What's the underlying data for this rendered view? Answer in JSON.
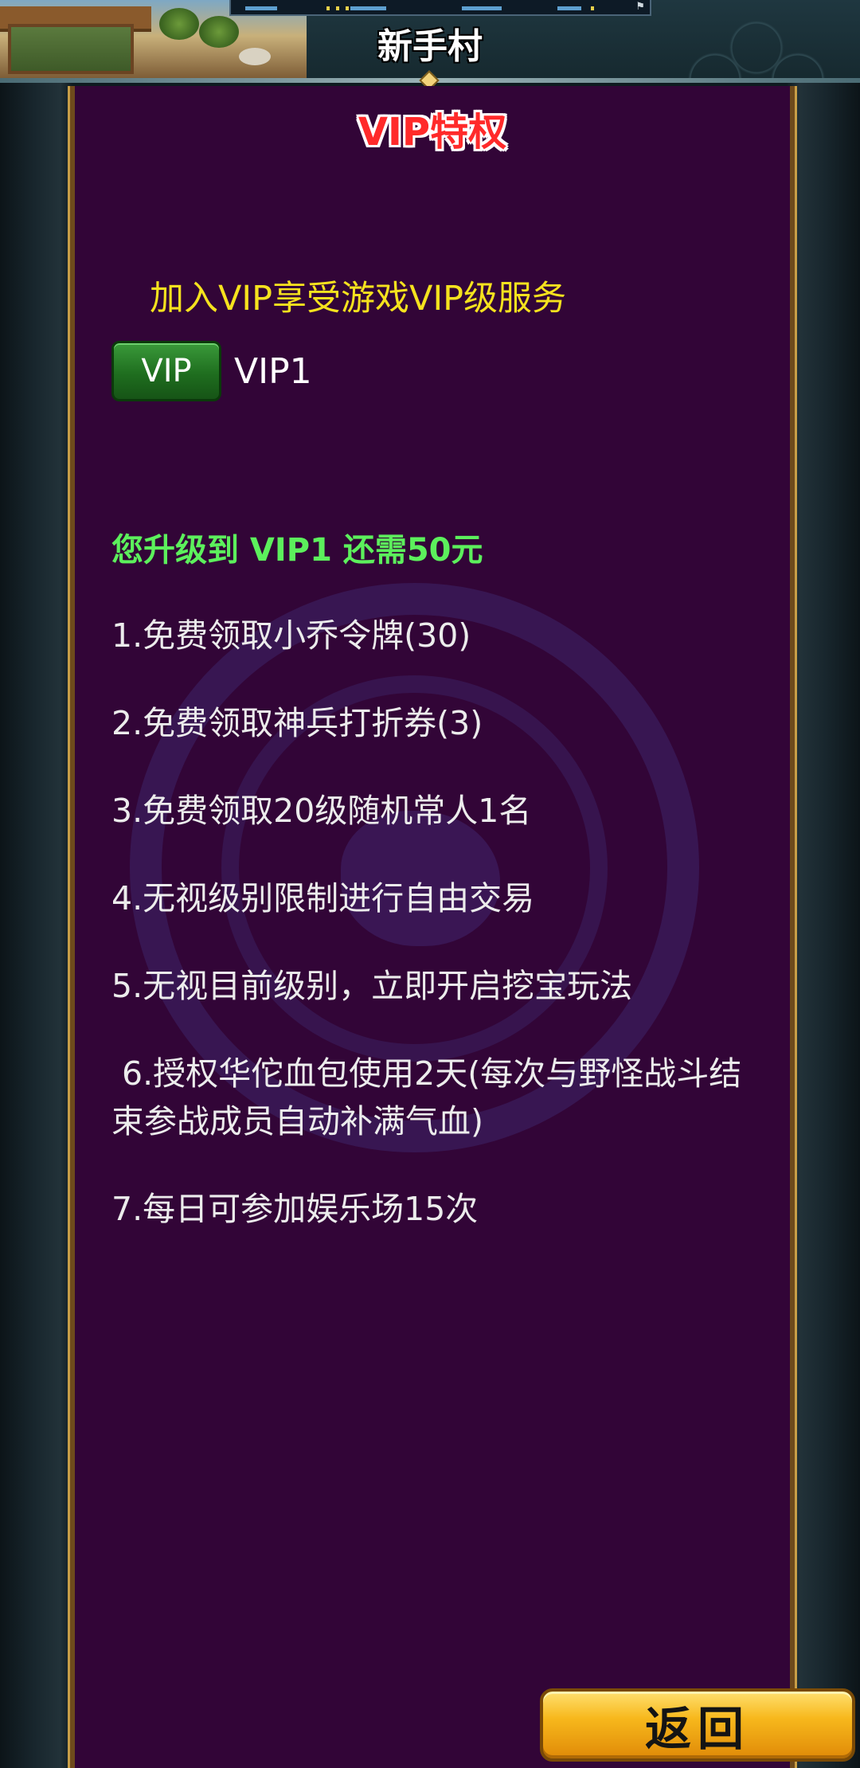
{
  "header": {
    "location_title": "新手村"
  },
  "panel": {
    "title": "VIP特权",
    "intro": "加入VIP享受游戏VIP级服务",
    "vip_badge_label": "VIP",
    "vip_level": "VIP1",
    "upgrade_text": "您升级到 VIP1 还需50元",
    "privileges": [
      "1.免费领取小乔令牌(30)",
      "2.免费领取神兵打折券(3)",
      "3.免费领取20级随机常人1名",
      "4.无视级别限制进行自由交易",
      "5.无视目前级别，立即开启挖宝玩法",
      " 6.授权华佗血包使用2天(每次与野怪战斗结束参战成员自动补满气血)",
      "7.每日可参加娱乐场15次"
    ]
  },
  "actions": {
    "back_label": "返回"
  },
  "colors": {
    "panel_bg": "#320537",
    "panel_border": "#c89e47",
    "title_red": "#ff2a2a",
    "intro_yellow": "#f5e21e",
    "upgrade_green": "#5cf05c",
    "vip_badge_green": "#1f6e1f",
    "back_button_gold": "#f7b81c"
  }
}
